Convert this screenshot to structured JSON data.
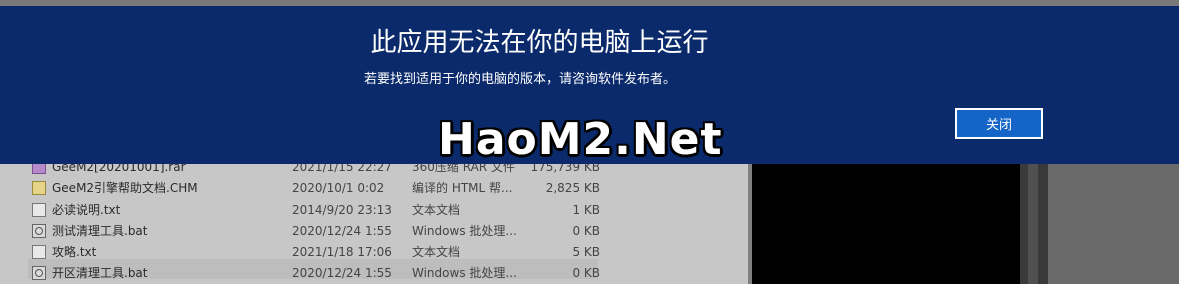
{
  "dialog": {
    "title": "此应用无法在你的电脑上运行",
    "message": "若要找到适用于你的电脑的版本，请咨询软件发布者。",
    "close_label": "关闭"
  },
  "watermark": "HaoM2.Net",
  "files": [
    {
      "name": "GeeM2[20201001].rar",
      "date": "2021/1/15 22:27",
      "type": "360压缩 RAR 文件",
      "size": "175,739 KB",
      "icon": "rar-file-icon"
    },
    {
      "name": "GeeM2引擎帮助文档.CHM",
      "date": "2020/10/1 0:02",
      "type": "编译的 HTML 帮...",
      "size": "2,825 KB",
      "icon": "chm-file-icon"
    },
    {
      "name": "必读说明.txt",
      "date": "2014/9/20 23:13",
      "type": "文本文档",
      "size": "1 KB",
      "icon": "text-file-icon"
    },
    {
      "name": "测试清理工具.bat",
      "date": "2020/12/24 1:55",
      "type": "Windows 批处理...",
      "size": "0 KB",
      "icon": "batch-file-icon"
    },
    {
      "name": "攻略.txt",
      "date": "2021/1/18 17:06",
      "type": "文本文档",
      "size": "5 KB",
      "icon": "text-file-icon"
    },
    {
      "name": "开区清理工具.bat",
      "date": "2020/12/24 1:55",
      "type": "Windows 批处理...",
      "size": "0 KB",
      "icon": "batch-file-icon"
    }
  ],
  "colors": {
    "dialog_bg": "#0b2a6b",
    "button_bg": "#1565c8"
  }
}
